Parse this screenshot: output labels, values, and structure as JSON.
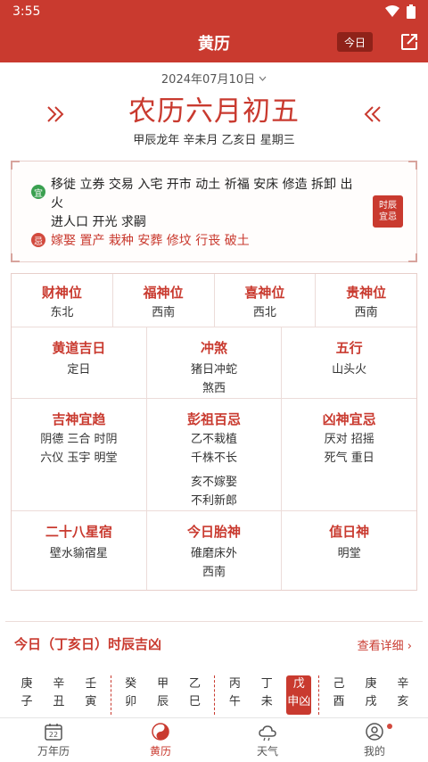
{
  "status_bar": {
    "time": "3:55"
  },
  "app_bar": {
    "title": "黄历",
    "today_label": "今日"
  },
  "date": {
    "solar": "2024年07月10日",
    "lunar": "农历六月初五",
    "ganzhi": "甲辰龙年 辛未月 乙亥日 星期三"
  },
  "yiji": {
    "yi_badge": "宜",
    "yi_line1": "移徙 立券 交易 入宅 开市 动土 祈福 安床 修造 拆卸 出火",
    "yi_line2": "进人口 开光 求嗣",
    "ji_badge": "忌",
    "ji_text": "嫁娶 置产 栽种 安葬 修坟 行丧 破土",
    "shichen_btn_line1": "时辰",
    "shichen_btn_line2": "宜忌"
  },
  "gods": [
    {
      "title": "财神位",
      "value": "东北"
    },
    {
      "title": "福神位",
      "value": "西南"
    },
    {
      "title": "喜神位",
      "value": "西北"
    },
    {
      "title": "贵神位",
      "value": "西南"
    }
  ],
  "row2": [
    {
      "title": "黄道吉日",
      "lines": [
        "定日"
      ]
    },
    {
      "title": "冲煞",
      "lines": [
        "猪日冲蛇",
        "煞西"
      ]
    },
    {
      "title": "五行",
      "lines": [
        "山头火"
      ]
    }
  ],
  "row3": [
    {
      "title": "吉神宜趋",
      "lines": [
        "阴德 三合 时阴",
        "六仪 玉宇 明堂"
      ]
    },
    {
      "title": "彭祖百忌",
      "lines": [
        "乙不栽植",
        "千株不长",
        "亥不嫁娶",
        "不利新郎"
      ]
    },
    {
      "title": "凶神宜忌",
      "lines": [
        "厌对 招摇",
        "死气 重日"
      ]
    }
  ],
  "row4": [
    {
      "title": "二十八星宿",
      "lines": [
        "壁水貐宿星"
      ]
    },
    {
      "title": "今日胎神",
      "lines": [
        "碓磨床外",
        "西南"
      ]
    },
    {
      "title": "值日神",
      "lines": [
        "明堂"
      ]
    }
  ],
  "shichen": {
    "heading": "今日（丁亥日）时辰吉凶",
    "more": "查看详细",
    "columns": [
      {
        "top": "庚",
        "bottom": "子"
      },
      {
        "top": "辛",
        "bottom": "丑"
      },
      {
        "top": "壬",
        "bottom": "寅"
      },
      {
        "top": "癸",
        "bottom": "卯"
      },
      {
        "top": "甲",
        "bottom": "辰"
      },
      {
        "top": "乙",
        "bottom": "巳"
      },
      {
        "top": "丙",
        "bottom": "午"
      },
      {
        "top": "丁",
        "bottom": "未"
      },
      {
        "top": "戊",
        "bottom": "申凶"
      },
      {
        "top": "己",
        "bottom": "酉"
      },
      {
        "top": "庚",
        "bottom": "戌"
      },
      {
        "top": "辛",
        "bottom": "亥"
      }
    ]
  },
  "tabs": [
    {
      "label": "万年历",
      "icon": "calendar-icon",
      "day": "22"
    },
    {
      "label": "黄历",
      "icon": "yinyang-icon"
    },
    {
      "label": "天气",
      "icon": "cloud-icon"
    },
    {
      "label": "我的",
      "icon": "user-icon"
    }
  ],
  "colors": {
    "primary": "#c93a2f",
    "yi": "#3aa050",
    "ji": "#d24a3e"
  }
}
